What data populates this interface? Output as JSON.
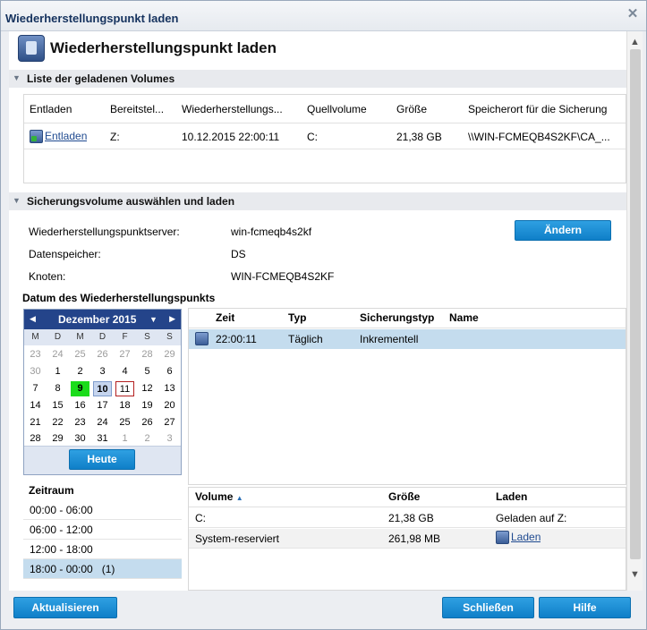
{
  "window": {
    "title": "Wiederherstellungspunkt laden"
  },
  "header": {
    "title": "Wiederherstellungspunkt laden"
  },
  "section1": {
    "title": "Liste der geladenen Volumes",
    "columns": [
      "Entladen",
      "Bereitstel...",
      "Wiederherstellungs...",
      "Quellvolume",
      "Größe",
      "Speicherort für die Sicherung"
    ],
    "rows": [
      {
        "action": "Entladen",
        "mount": "Z:",
        "recovery_point": "10.12.2015 22:00:11",
        "source": "C:",
        "size": "21,38 GB",
        "location": "\\\\WIN-FCMEQB4S2KF\\CA_..."
      }
    ]
  },
  "section2": {
    "title": "Sicherungsvolume auswählen und laden",
    "server_label": "Wiederherstellungspunktserver:",
    "server_value": "win-fcmeqb4s2kf",
    "datastore_label": "Datenspeicher:",
    "datastore_value": "DS",
    "node_label": "Knoten:",
    "node_value": "WIN-FCMEQB4S2KF",
    "change_button": "Ändern",
    "date_label": "Datum des Wiederherstellungspunkts"
  },
  "calendar": {
    "month": "Dezember 2015",
    "weekdays": [
      "M",
      "D",
      "M",
      "D",
      "F",
      "S",
      "S"
    ],
    "weeks": [
      [
        "23",
        "24",
        "25",
        "26",
        "27",
        "28",
        "29"
      ],
      [
        "30",
        "1",
        "2",
        "3",
        "4",
        "5",
        "6"
      ],
      [
        "7",
        "8",
        "9",
        "10",
        "11",
        "12",
        "13"
      ],
      [
        "14",
        "15",
        "16",
        "17",
        "18",
        "19",
        "20"
      ],
      [
        "21",
        "22",
        "23",
        "24",
        "25",
        "26",
        "27"
      ],
      [
        "28",
        "29",
        "30",
        "31",
        "1",
        "2",
        "3"
      ]
    ],
    "today_button": "Heute"
  },
  "timerange": {
    "title": "Zeitraum",
    "items": [
      "00:00 - 06:00",
      "06:00 - 12:00",
      "12:00 - 18:00",
      "18:00 - 00:00   (1)"
    ]
  },
  "points_table": {
    "columns": [
      "Zeit",
      "Typ",
      "Sicherungstyp",
      "Name"
    ],
    "rows": [
      {
        "time": "22:00:11",
        "type": "Täglich",
        "backup_type": "Inkrementell",
        "name": ""
      }
    ]
  },
  "volumes_table": {
    "columns": [
      "Volume",
      "Größe",
      "Laden"
    ],
    "sort_indicator": "▲",
    "rows": [
      {
        "volume": "C:",
        "size": "21,38 GB",
        "load": "Geladen auf Z:"
      },
      {
        "volume": "System-reserviert",
        "size": "261,98 MB",
        "load": "Laden"
      }
    ]
  },
  "footer": {
    "refresh": "Aktualisieren",
    "close": "Schließen",
    "help": "Hilfe"
  }
}
